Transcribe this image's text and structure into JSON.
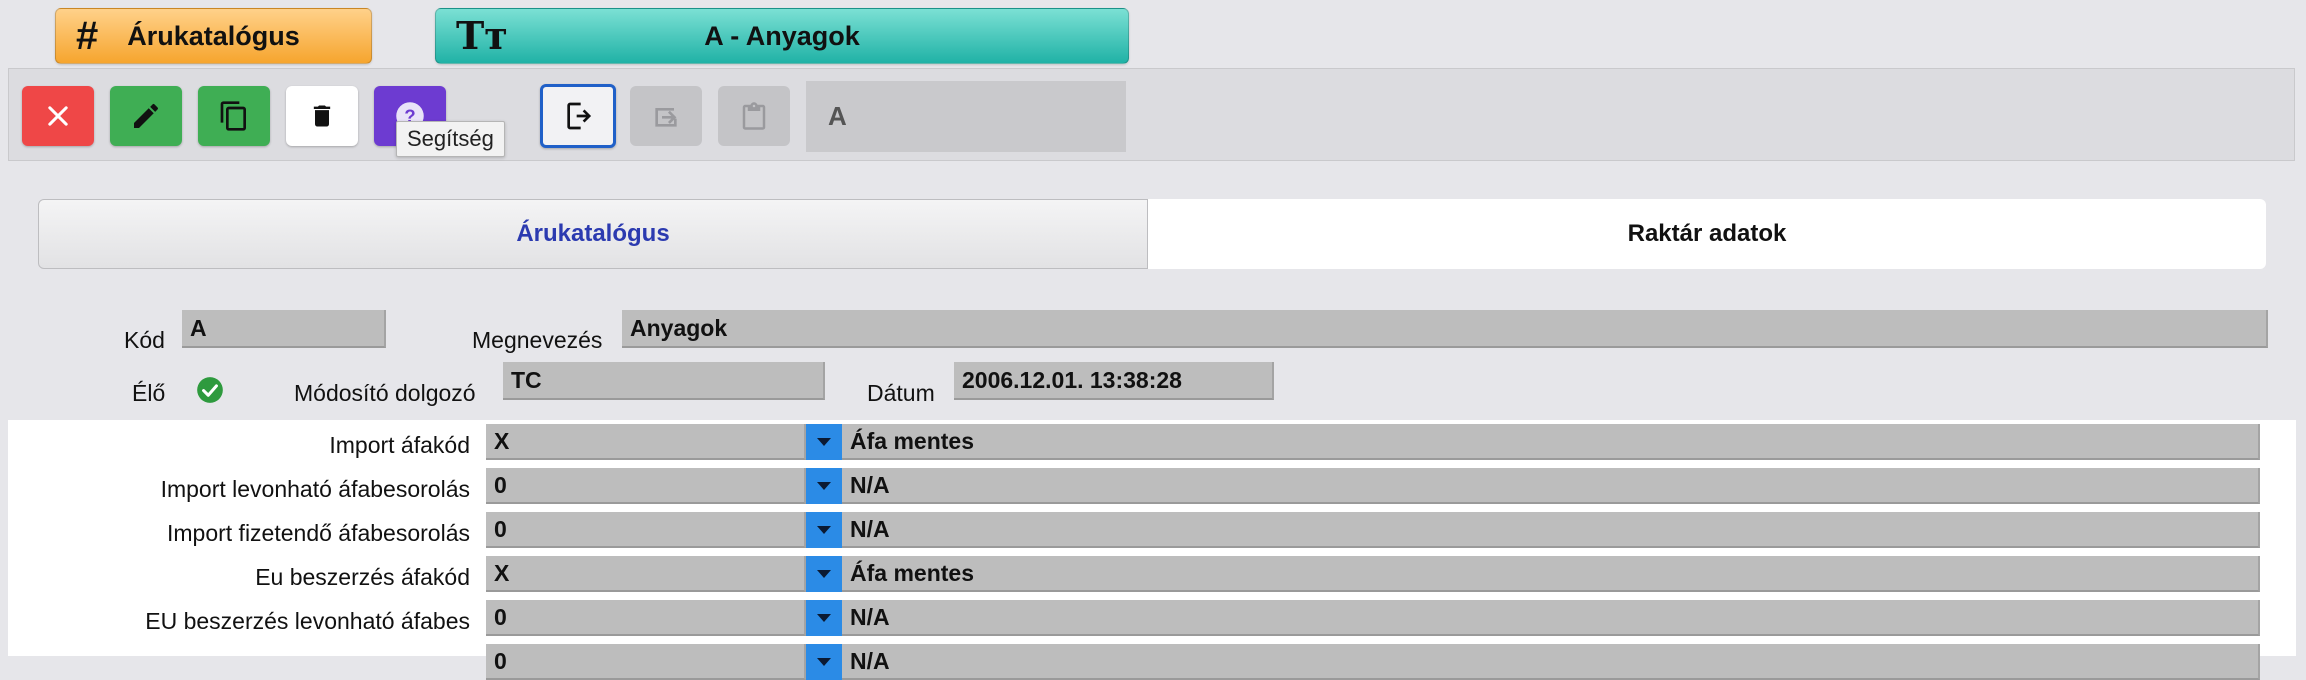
{
  "header": {
    "catalog_tab": {
      "label": "Árukatalógus",
      "icon": "hash-icon"
    },
    "record_tab": {
      "label": "A - Anyagok",
      "icon": "text-size-icon"
    }
  },
  "toolbar": {
    "tooltip": "Segítség",
    "filter_value": "A",
    "colors": {
      "close": "#ef4747",
      "edit": "#3fae54",
      "help": "#6d3bd1",
      "active_outline": "#2060c8"
    }
  },
  "tabs": [
    {
      "label": "Árukatalógus",
      "active": false
    },
    {
      "label": "Raktár adatok",
      "active": true
    }
  ],
  "form": {
    "kod_label": "Kód",
    "kod_value": "A",
    "megnevezes_label": "Megnevezés",
    "megnevezes_value": "Anyagok",
    "elo_label": "Élő",
    "modosito_label": "Módosító dolgozó",
    "modosito_value": "TC",
    "datum_label": "Dátum",
    "datum_value": "2006.12.01. 13:38:28"
  },
  "vat_rows": [
    {
      "label": "Import áfakód",
      "code": "X",
      "description": "Áfa mentes"
    },
    {
      "label": "Import levonható áfabesorolás",
      "code": "0",
      "description": "N/A"
    },
    {
      "label": "Import fizetendő áfabesorolás",
      "code": "0",
      "description": "N/A"
    },
    {
      "label": "Eu beszerzés áfakód",
      "code": "X",
      "description": "Áfa mentes"
    },
    {
      "label": "EU beszerzés levonható áfabes",
      "code": "0",
      "description": "N/A"
    },
    {
      "label": "",
      "code": "0",
      "description": "N/A"
    }
  ]
}
